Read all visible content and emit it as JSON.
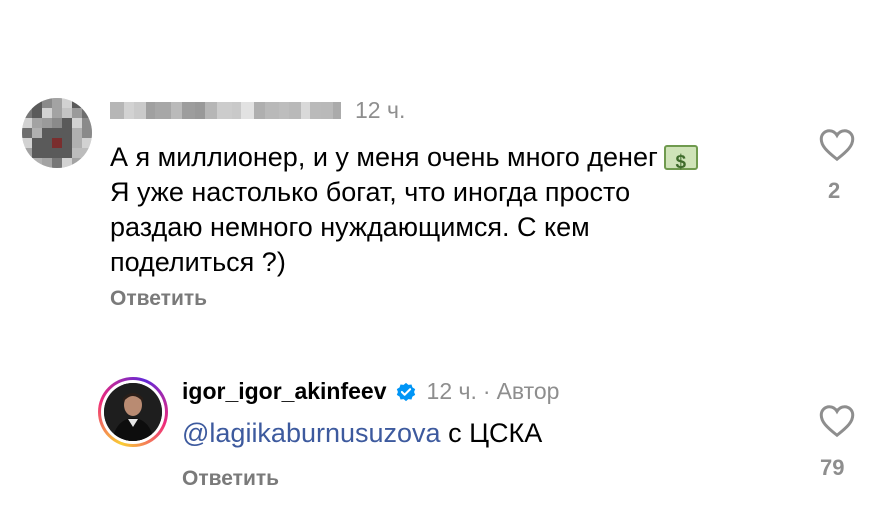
{
  "comments": [
    {
      "username_obscured": true,
      "time": "12 ч.",
      "text_lines": [
        "А я миллионер, и у меня очень много денег",
        "Я уже настолько богат, что иногда просто",
        "раздаю немного нуждающимся. С кем",
        "поделиться ?)"
      ],
      "emoji": "money-bills",
      "reply_label": "Ответить",
      "like_count": "2"
    },
    {
      "username": "igor_igor_akinfeev",
      "verified": true,
      "time": "12 ч.",
      "separator": "·",
      "author_badge": "Автор",
      "mention": "@lagiikaburnusuzova",
      "text": " с ЦСКА",
      "reply_label": "Ответить",
      "like_count": "79"
    }
  ],
  "colors": {
    "muted": "#8e8e8e",
    "mention": "#3d5a9e",
    "verified": "#0095f6"
  },
  "icons": {
    "like": "heart-outline-icon",
    "verified": "verified-badge-icon"
  }
}
